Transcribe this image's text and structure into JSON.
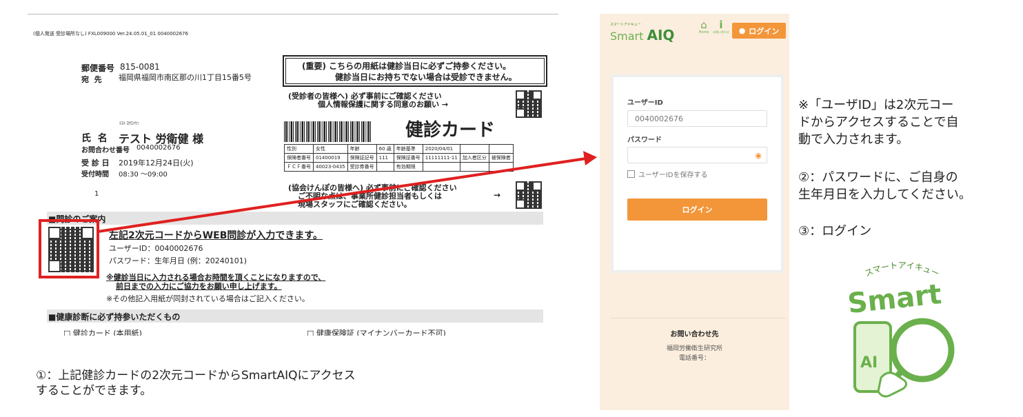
{
  "document": {
    "header_line": "(個人発送 受診場所なし) FXL009000 Ver.24.05.01_01 0040002676",
    "postal_label": "郵便番号",
    "postal_code": "815-0081",
    "address_label": "宛  先",
    "address": "福岡県福岡市南区那の川1丁目15番5号",
    "notice_line1": "(重要) こちらの用紙は健診当日に必ずご持参ください。",
    "notice_line2": "健診当日にお持ちでない場合は受診できません。",
    "examinee_line1": "(受診者の皆様へ) 必ず事前にご確認ください",
    "examinee_line2": "個人情報保護に関する同意のお願い →",
    "furigana": "ﾃｽﾄ ﾛｳｴｲｹﾝ",
    "name_label": "氏  名",
    "name": "テスト 労衛健 様",
    "inquiry_label": "お問合わせ番号",
    "inquiry_number": "0040002676",
    "exam_date_label": "受 診 日",
    "exam_date": "2019年12月24日(火)",
    "reception_label": "受付時間",
    "reception_time": "08:30 ～09:00",
    "page_num": "1",
    "card_title": "健診カード",
    "info_table": [
      [
        "性別",
        "女性",
        "年齢",
        "60 歳",
        "年齢基準",
        "2020/04/01",
        "",
        ""
      ],
      [
        "保険者番号",
        "01400019",
        "保険証記号",
        "111",
        "保険証番号",
        "11111111-11",
        "加入者区分",
        "被保険者"
      ],
      [
        "ＦＣＦ番号",
        "40023-0435",
        "受診券番号",
        "",
        "有効期限",
        "",
        "",
        ""
      ]
    ],
    "kyokai_line1": "(協会けんぽの皆様へ) 必ず事前にご確認ください",
    "kyokai_line2": "ご不明な点は、事業所健診担当者もしくは",
    "kyokai_line3": "現場スタッフにご確認ください。",
    "arrow": "→",
    "section1_title": "■問診のご案内",
    "qr_heading": "左記2次元コードからWEB問診が入力できます。",
    "user_id_line": "ユーザーID：0040002676",
    "password_line": "パスワード：生年月日 (例：20240101)",
    "note1_line1": "※健診当日に入力される場合お時間を頂くことになりますので、",
    "note1_line2": "前日までの入力にご協力をお願い申し上げます。",
    "note2": "※その他記入用紙が同封されている場合はご記入ください。",
    "section2_title": "■健康診断に必ず持参いただくもの",
    "item1": "□ 健診カード (本用紙)",
    "item2": "□ 健康保険証 (マイナンバーカード不可)"
  },
  "caption1_line1": "①：上記健診カードの2次元コードからSmartAIQにアクセス",
  "caption1_line2": "することができます。",
  "phone": {
    "logo_kana": "スマートアイキュー",
    "logo_text": "Smart",
    "logo_aiq": "AIQ",
    "home_label": "Home",
    "inquiry_label": "お問い合わせ",
    "top_login": "ログイン",
    "userid_label": "ユーザーID",
    "userid_value": "0040002676",
    "password_label": "パスワード",
    "save_label": "ユーザーIDを保存する",
    "login_button": "ログイン",
    "footer_title": "お問い合わせ先",
    "footer_org": "福岡労働衛生研究所",
    "footer_tel": "電話番号："
  },
  "notes": {
    "userid_note_l1": "※「ユーザID」は2次元コー",
    "userid_note_l2": "ドからアクセスすることで自",
    "userid_note_l3": "動で入力されます。",
    "password_note_l1": "②：パスワードに、ご自身の",
    "password_note_l2": "生年月日を入力してください。",
    "login_note": "③：ログイン"
  },
  "logo": {
    "kana": "スマートアイキュー",
    "smart": "Smart",
    "ai": "AI"
  },
  "colors": {
    "accent": "#f3963a",
    "logo_green": "#6ab04c",
    "highlight_red": "#e02020",
    "phone_bg": "#fbeede"
  }
}
